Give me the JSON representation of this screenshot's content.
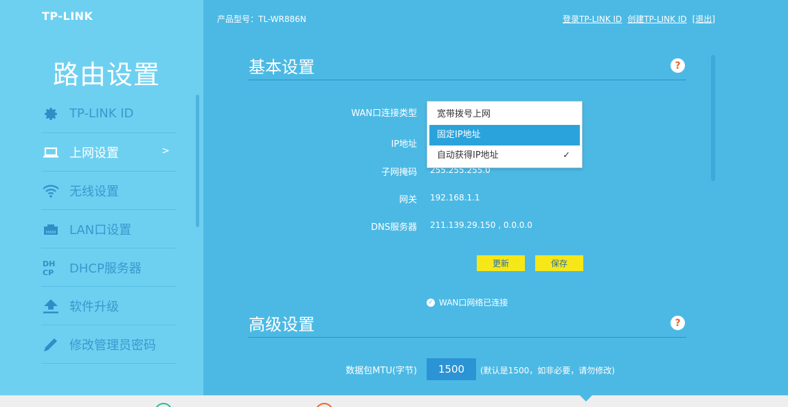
{
  "brand": {
    "logo": "TP-LINK"
  },
  "sidebar": {
    "title": "路由设置",
    "items": [
      {
        "label": "TP-LINK ID",
        "icon": "gear-icon"
      },
      {
        "label": "上网设置",
        "icon": "laptop-icon",
        "arrow": ">"
      },
      {
        "label": "无线设置",
        "icon": "wifi-icon"
      },
      {
        "label": "LAN口设置",
        "icon": "lan-port-icon"
      },
      {
        "label": "DHCP服务器",
        "icon": "dhcp-icon"
      },
      {
        "label": "软件升级",
        "icon": "upload-icon"
      },
      {
        "label": "修改管理员密码",
        "icon": "pencil-icon"
      }
    ]
  },
  "header": {
    "model": "产品型号：TL-WR886N",
    "login_link": "登录TP-LINK ID",
    "create_link": "创建TP-LINK ID",
    "logout_link": "[退出]"
  },
  "basic": {
    "title": "基本设置",
    "help": "?",
    "wan_type_label": "WAN口连接类型",
    "ip_label": "IP地址",
    "subnet_label": "子网掩码",
    "subnet_value": "255.255.255.0",
    "gateway_label": "网关",
    "gateway_value": "192.168.1.1",
    "dns_label": "DNS服务器",
    "dns_value": "211.139.29.150 , 0.0.0.0",
    "refresh_button": "更新",
    "save_button": "保存",
    "status_text": "WAN口网络已连接"
  },
  "dropdown": {
    "options": [
      "宽带拨号上网",
      "固定IP地址",
      "自动获得IP地址"
    ],
    "highlighted": "固定IP地址",
    "selected": "自动获得IP地址",
    "check": "✓"
  },
  "advanced": {
    "title": "高级设置",
    "help": "?",
    "mtu_label": "数据包MTU(字节)",
    "mtu_value": "1500",
    "mtu_hint": "(默认是1500，如非必要，请勿修改)"
  },
  "colors": {
    "background": "#4cb9e4",
    "sidebar": "#6ed0f0",
    "button": "#f6e719",
    "help_icon": "#e8662b",
    "dropdown_highlight": "#2aa3dc"
  }
}
